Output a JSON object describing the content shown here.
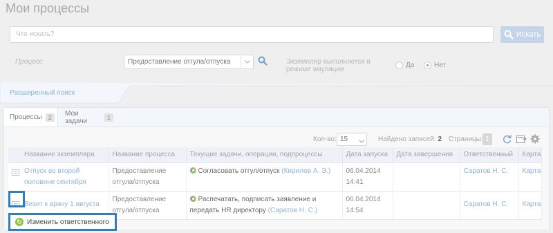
{
  "page": {
    "title": "Мои процессы"
  },
  "search": {
    "placeholder": "Что искать?",
    "button_label": "Искать"
  },
  "filters": {
    "process_label": "Процесс",
    "process_value": "Предоставление отгула/отпуска",
    "emulation_label_line1": "Экземпляр выполняется в",
    "emulation_label_line2": "режиме эмуляции",
    "yes_label": "Да",
    "no_label": "Нет",
    "selected": "Нет",
    "advanced_search": "Расширенный поиск"
  },
  "tabs": [
    {
      "label": "Процессы",
      "count": "2",
      "active": true
    },
    {
      "label": "Мои задачи",
      "count": "1",
      "active": false
    }
  ],
  "toolbar": {
    "per_page_label": "Кол-во:",
    "per_page_value": "15",
    "found_label": "Найдено записей:",
    "found_value": "2",
    "pages_label": "Страницы:",
    "current_page": "1"
  },
  "table": {
    "columns": [
      "Название экземпляра",
      "Название процесса",
      "Текущие задачи, операции, подпроцессы",
      "Дата запуска",
      "Дата завершения",
      "Ответственный",
      "Карта"
    ],
    "rows": [
      {
        "instance": "Отпуск во второй половине сентября",
        "process": "Предоставление отгула/отпуска",
        "task": "Согласовать отгул/отпуск",
        "task_person": "(Кирилов А. Э.)",
        "start_date": "06.04.2014",
        "start_time": "14:41",
        "end_date": "",
        "responsible": "Саратов Н. С.",
        "map": "Карта"
      },
      {
        "instance": "Визит к врачу 1 августа",
        "process": "Предоставление отгула/отпуска",
        "task": "Распечатать, подписать заявление и передать HR директору",
        "task_person": "(Саратов Н. С.)",
        "start_date": "06.04.2014",
        "start_time": "14:54",
        "end_date": "",
        "responsible": "Саратов Н. С.",
        "map": "Карта"
      }
    ]
  },
  "popup": {
    "item_label": "Изменить ответственного"
  },
  "colors": {
    "link": "#8fb4d8",
    "highlight": "#2d7fc0",
    "search_button": "#c4d5ea",
    "tab_bg": "#f3f6fb",
    "popup_icon": "#8cc63f"
  },
  "icons": [
    "search-icon",
    "chevron-down-icon",
    "row-menu-icon",
    "refresh-icon",
    "export-icon",
    "gear-icon",
    "process-status-icon",
    "change-owner-icon"
  ]
}
